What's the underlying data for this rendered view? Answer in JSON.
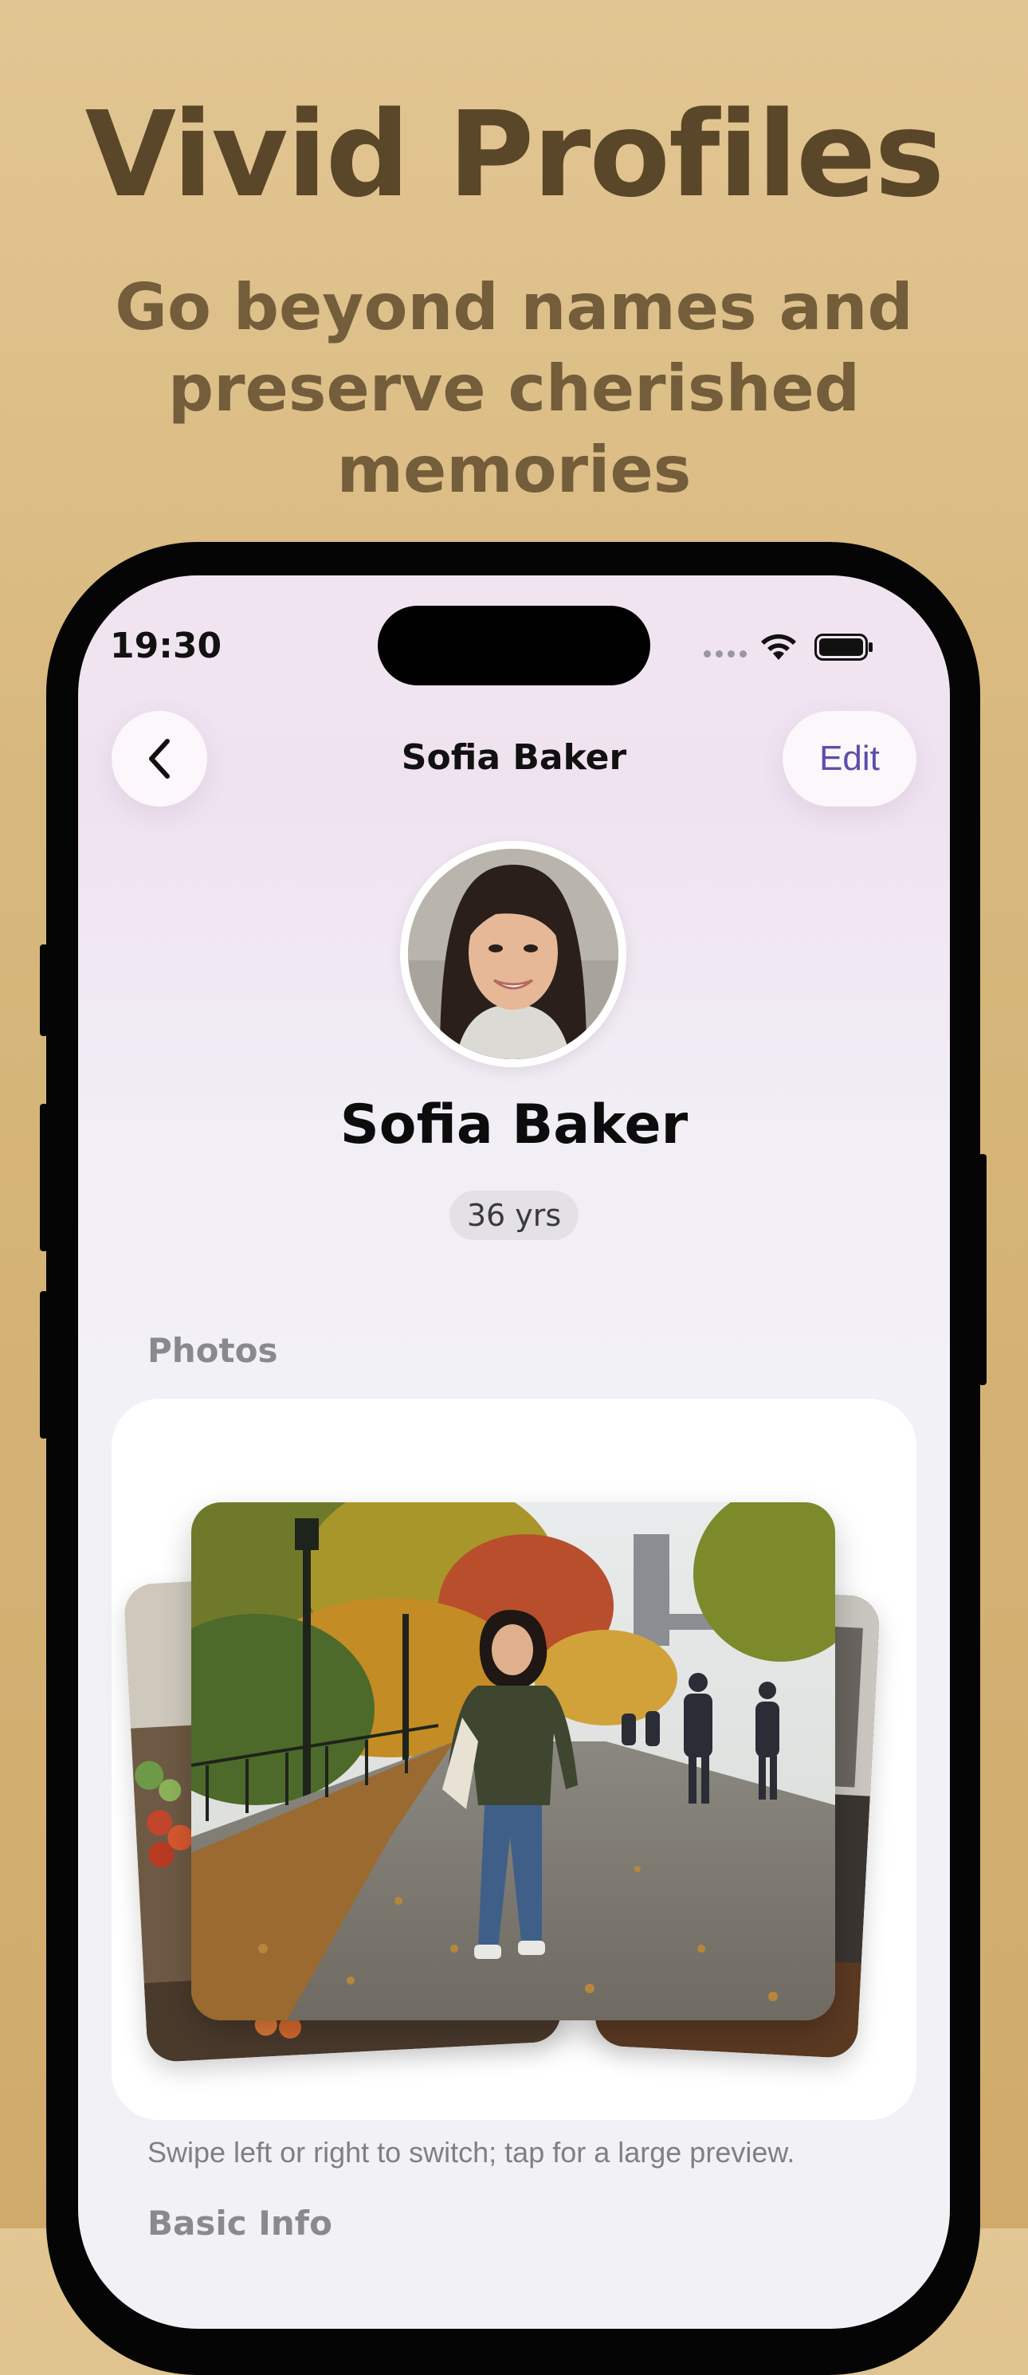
{
  "hero": {
    "title": "Vivid Profiles",
    "subtitle_line1": "Go beyond names and",
    "subtitle_line2": "preserve cherished",
    "subtitle_line3": "memories"
  },
  "status_bar": {
    "time": "19:30"
  },
  "nav": {
    "back_icon": "chevron-left-icon",
    "title": "Sofia Baker",
    "edit_label": "Edit"
  },
  "profile": {
    "name": "Sofia Baker",
    "age": "36 yrs"
  },
  "photos": {
    "section_title": "Photos",
    "caption": "Swipe left or right to switch; tap for a large preview."
  },
  "basic_info": {
    "section_title": "Basic Info"
  },
  "colors": {
    "accent": "#5a4fa8",
    "hero_title": "#5a4628",
    "background": "#d8b87d"
  }
}
